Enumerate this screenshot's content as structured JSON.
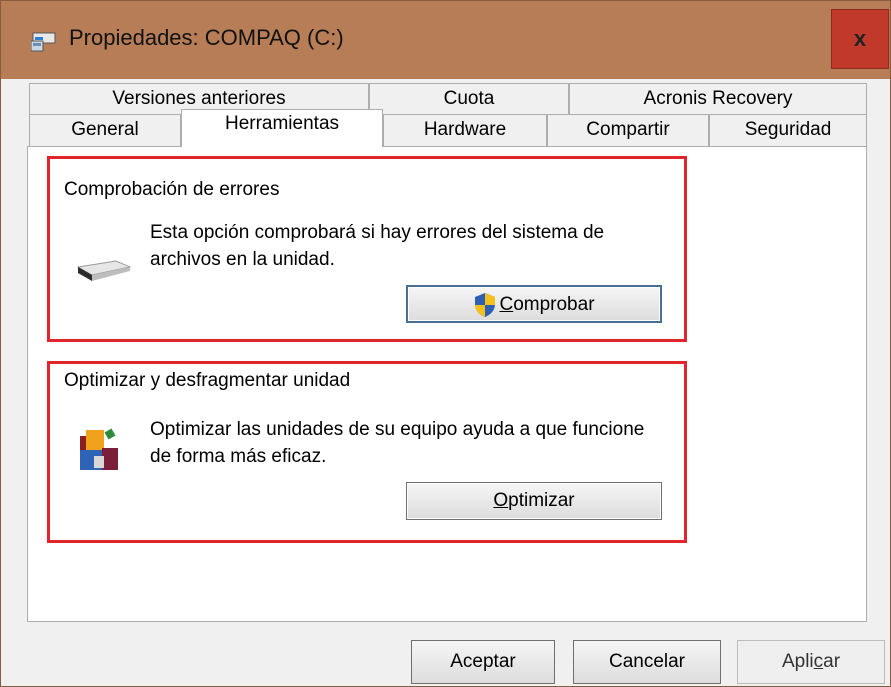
{
  "window": {
    "title": "Propiedades: COMPAQ (C:)",
    "close_label": "x"
  },
  "tabs_row1": [
    {
      "label": "Versiones anteriores"
    },
    {
      "label": "Cuota"
    },
    {
      "label": "Acronis Recovery"
    }
  ],
  "tabs_row2": [
    {
      "label": "General"
    },
    {
      "label": "Herramientas",
      "active": true
    },
    {
      "label": "Hardware"
    },
    {
      "label": "Compartir"
    },
    {
      "label": "Seguridad"
    }
  ],
  "error_check": {
    "title": "Comprobación de errores",
    "description": "Esta opción comprobará si hay errores del sistema de archivos en la unidad.",
    "button_mnemonic": "C",
    "button_rest": "omprobar",
    "icon": "drive-icon"
  },
  "optimize": {
    "title": "Optimizar y desfragmentar unidad",
    "description": "Optimizar las unidades de su equipo ayuda a que funcione de forma más eficaz.",
    "button_mnemonic": "O",
    "button_rest": "ptimizar",
    "icon": "defrag-icon"
  },
  "footer": {
    "ok_label": "Aceptar",
    "cancel_label": "Cancelar",
    "apply_before": "Apli",
    "apply_mnemonic": "c",
    "apply_after": "ar"
  },
  "colors": {
    "titlebar": "#b77d57",
    "close": "#c0392b",
    "highlight_border": "#e0252f"
  }
}
